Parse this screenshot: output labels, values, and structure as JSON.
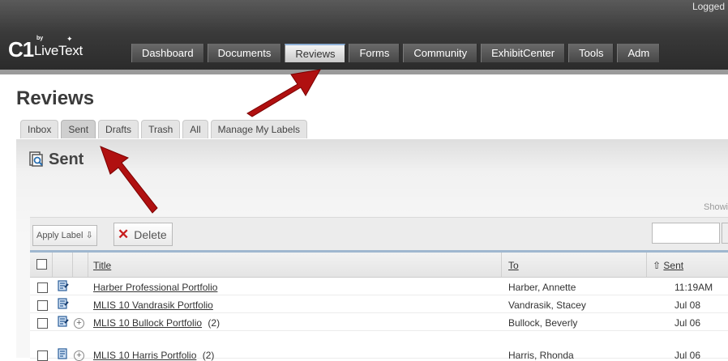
{
  "header": {
    "logged_text": "Logged",
    "logo_c1": "C1",
    "logo_by": "by",
    "logo_text": "LiveText"
  },
  "nav": {
    "tabs": [
      {
        "label": "Dashboard"
      },
      {
        "label": "Documents"
      },
      {
        "label": "Reviews",
        "active": true
      },
      {
        "label": "Forms"
      },
      {
        "label": "Community"
      },
      {
        "label": "ExhibitCenter"
      },
      {
        "label": "Tools"
      },
      {
        "label": "Adm"
      }
    ]
  },
  "page": {
    "title": "Reviews",
    "section_title": "Sent",
    "showing": "Showi"
  },
  "subtabs": [
    {
      "label": "Inbox"
    },
    {
      "label": "Sent",
      "active": true
    },
    {
      "label": "Drafts"
    },
    {
      "label": "Trash"
    },
    {
      "label": "All"
    },
    {
      "label": "Manage My Labels"
    }
  ],
  "toolbar": {
    "apply_label": "Apply Label",
    "apply_arrow": "⇩",
    "delete_label": "Delete",
    "delete_icon": "✕"
  },
  "table": {
    "headers": {
      "title": "Title",
      "to": "To",
      "sent": "Sent",
      "sent_sort_icon": "⇧"
    },
    "rows": [
      {
        "title": "Harber Professional Portfolio",
        "to": "Harber, Annette",
        "sent": "11:19AM",
        "expand": false
      },
      {
        "title": "MLIS 10 Vandrasik Portfolio",
        "to": "Vandrasik, Stacey",
        "sent": "Jul 08",
        "expand": false
      },
      {
        "title": "MLIS 10 Bullock Portfolio",
        "count": "(2)",
        "to": "Bullock, Beverly",
        "sent": "Jul 06",
        "expand": true
      },
      {
        "title": "MLIS 10 Harris Portfolio",
        "count": "(2)",
        "to": "Harris, Rhonda",
        "sent": "Jul 06",
        "expand": true
      }
    ]
  },
  "colors": {
    "arrow": "#b01010",
    "accent": "#9fb7cf",
    "delete_x": "#c81e1e"
  }
}
